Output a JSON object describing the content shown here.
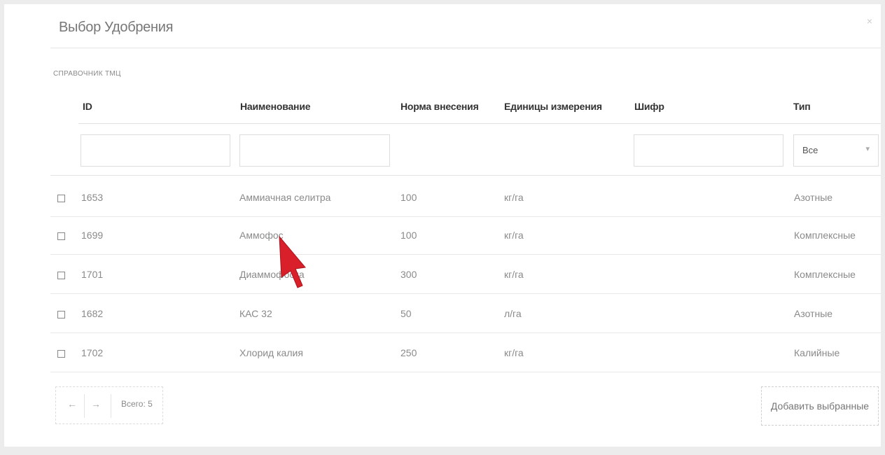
{
  "dialog": {
    "title": "Выбор Удобрения",
    "close_glyph": "×",
    "subtitle": "СПРАВОЧНИК ТМЦ"
  },
  "table": {
    "columns": {
      "id": "ID",
      "name": "Наименование",
      "rate": "Норма внесения",
      "units": "Единицы измерения",
      "code": "Шифр",
      "type": "Тип"
    },
    "type_filter_value": "Все",
    "rows": [
      {
        "id": "1653",
        "name": "Аммиачная селитра",
        "rate": "100",
        "units": "кг/га",
        "type": "Азотные"
      },
      {
        "id": "1699",
        "name": "Аммофос",
        "rate": "100",
        "units": "кг/га",
        "type": "Комплексные"
      },
      {
        "id": "1701",
        "name": "Диаммофоска",
        "rate": "300",
        "units": "кг/га",
        "type": "Комплексные"
      },
      {
        "id": "1682",
        "name": "КАС 32",
        "rate": "50",
        "units": "л/га",
        "type": "Азотные"
      },
      {
        "id": "1702",
        "name": "Хлорид калия",
        "rate": "250",
        "units": "кг/га",
        "type": "Калийные"
      }
    ]
  },
  "pager": {
    "prev": "←",
    "next": "→",
    "total": "Всего: 5"
  },
  "add_button_label": "Добавить выбранные",
  "colors": {
    "cursor": "#d9202a",
    "border": "#e2e2e2"
  }
}
